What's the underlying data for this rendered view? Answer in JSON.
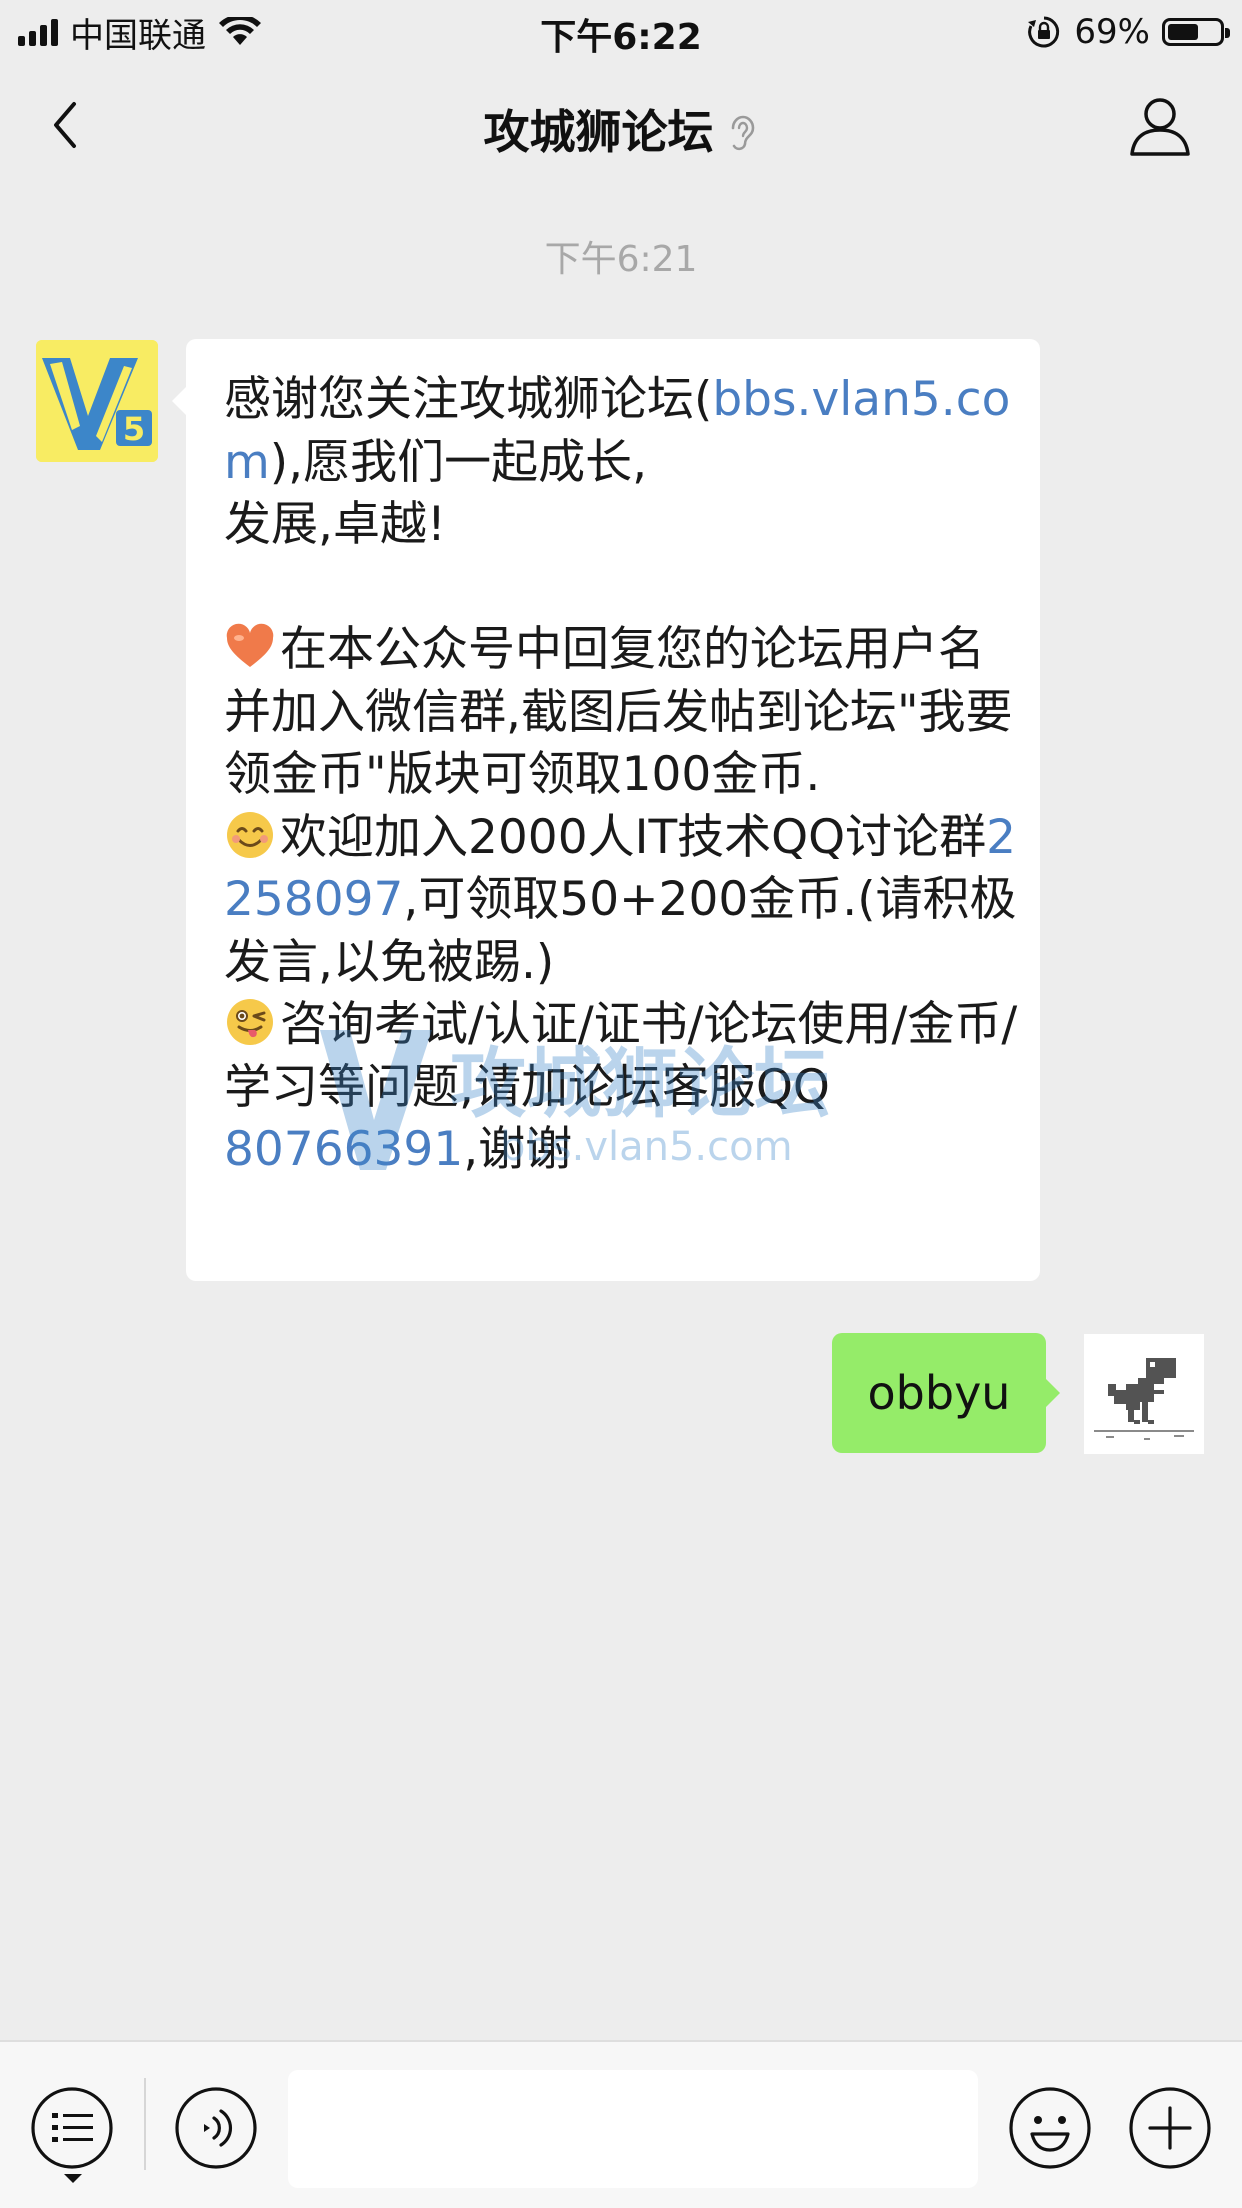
{
  "status_bar": {
    "carrier": "中国联通",
    "time": "下午6:22",
    "battery_percent": "69%",
    "battery_level": 0.69
  },
  "nav": {
    "title": "攻城狮论坛",
    "back_icon": "chevron-left-icon",
    "ear_icon": "ear-icon",
    "profile_icon": "person-icon"
  },
  "chat": {
    "timestamp": "下午6:21",
    "incoming": {
      "line1": "感谢您关注攻城狮论坛(",
      "link1": "bbs.vlan5.com",
      "line1b": "),愿我们一起成长,\n发展,卓越!\n\n",
      "p2": "在本公众号中回复您的论坛用户名并加入微信群,截图后发帖到论坛\"我要领金币\"版块可领取100金币.\n",
      "p3a": "欢迎加入2000人IT技术QQ讨论群",
      "qq_group": "2258097",
      "p3b": ",可领取50+200金币.(请积极发言,以免被踢.)\n",
      "p4a": "咨询考试/认证/证书/论坛使用/金币/学习等问题,请加论坛客服QQ\n",
      "qq_service": "80766391",
      "p4b": ",谢谢",
      "watermark_text": "攻城狮论坛",
      "watermark_url": "bbs.vlan5.com"
    },
    "outgoing": {
      "text": "obbyu"
    }
  },
  "bottom_bar": {
    "input_value": "",
    "icons": [
      "menu-list-icon",
      "voice-icon",
      "emoji-icon",
      "plus-icon"
    ]
  },
  "colors": {
    "background": "#ededed",
    "incoming_bubble": "#ffffff",
    "outgoing_bubble": "#95ec69",
    "link": "#4a7ec2",
    "avatar_bg": "#f8ec63"
  }
}
